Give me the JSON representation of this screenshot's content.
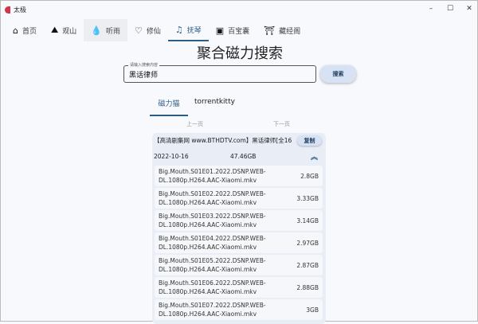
{
  "window": {
    "title": "太极",
    "minimize": "–",
    "maximize": "☐",
    "close": "✕"
  },
  "nav": [
    {
      "label": "首页",
      "icon": "⌂"
    },
    {
      "label": "观山",
      "icon": "⛰"
    },
    {
      "label": "听雨",
      "icon": "💧"
    },
    {
      "label": "修仙",
      "icon": "♡"
    },
    {
      "label": "抚琴",
      "icon": "♫"
    },
    {
      "label": "百宝囊",
      "icon": "▣"
    },
    {
      "label": "藏经阁",
      "icon": "⛩"
    }
  ],
  "page_title": "聚合磁力搜索",
  "search": {
    "label": "请输入搜索内容",
    "value": "黑话律师",
    "button": "搜索"
  },
  "sources": [
    "磁力猫",
    "torrentkitty"
  ],
  "pager": {
    "prev": "上一页",
    "next": "下一页"
  },
  "result": {
    "title": "【高清剧集网 www.BTHDTV.com】黑话律师[全16",
    "copy": "复制",
    "date": "2022-10-16",
    "size": "47.46GB",
    "collapse_icon": "︽",
    "files": [
      {
        "name": "Big.Mouth.S01E01.2022.DSNP.WEB-DL.1080p.H264.AAC-Xiaomi.mkv",
        "size": "2.8GB"
      },
      {
        "name": "Big.Mouth.S01E02.2022.DSNP.WEB-DL.1080p.H264.AAC-Xiaomi.mkv",
        "size": "3.33GB"
      },
      {
        "name": "Big.Mouth.S01E03.2022.DSNP.WEB-DL.1080p.H264.AAC-Xiaomi.mkv",
        "size": "3.14GB"
      },
      {
        "name": "Big.Mouth.S01E04.2022.DSNP.WEB-DL.1080p.H264.AAC-Xiaomi.mkv",
        "size": "2.97GB"
      },
      {
        "name": "Big.Mouth.S01E05.2022.DSNP.WEB-DL.1080p.H264.AAC-Xiaomi.mkv",
        "size": "2.87GB"
      },
      {
        "name": "Big.Mouth.S01E06.2022.DSNP.WEB-DL.1080p.H264.AAC-Xiaomi.mkv",
        "size": "2.88GB"
      },
      {
        "name": "Big.Mouth.S01E07.2022.DSNP.WEB-DL.1080p.H264.AAC-Xiaomi.mkv",
        "size": "3GB"
      }
    ]
  }
}
